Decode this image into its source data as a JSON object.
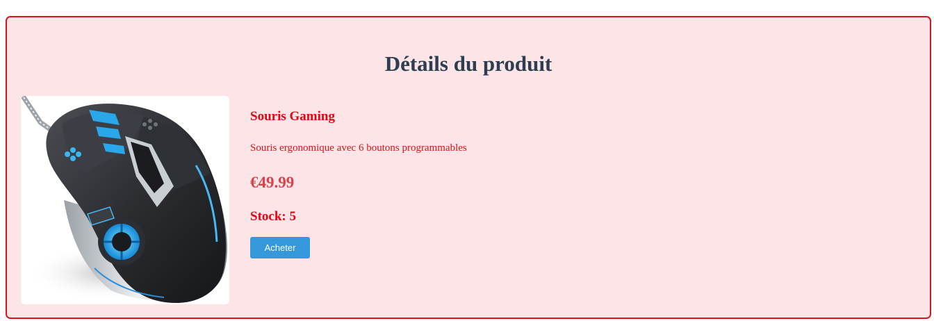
{
  "page": {
    "title": "Détails du produit"
  },
  "product": {
    "image_alt": "Souris Gaming",
    "name": "Souris Gaming",
    "description": "Souris ergonomique avec 6 boutons programmables",
    "price": "€49.99",
    "stock": "Stock: 5",
    "buy_label": "Acheter"
  },
  "colors": {
    "card_background": "#fde4e6",
    "card_border": "#d9141c",
    "title": "#2c3e50",
    "product_text": "#e30613",
    "price": "#d9414b",
    "button": "#3498db"
  }
}
